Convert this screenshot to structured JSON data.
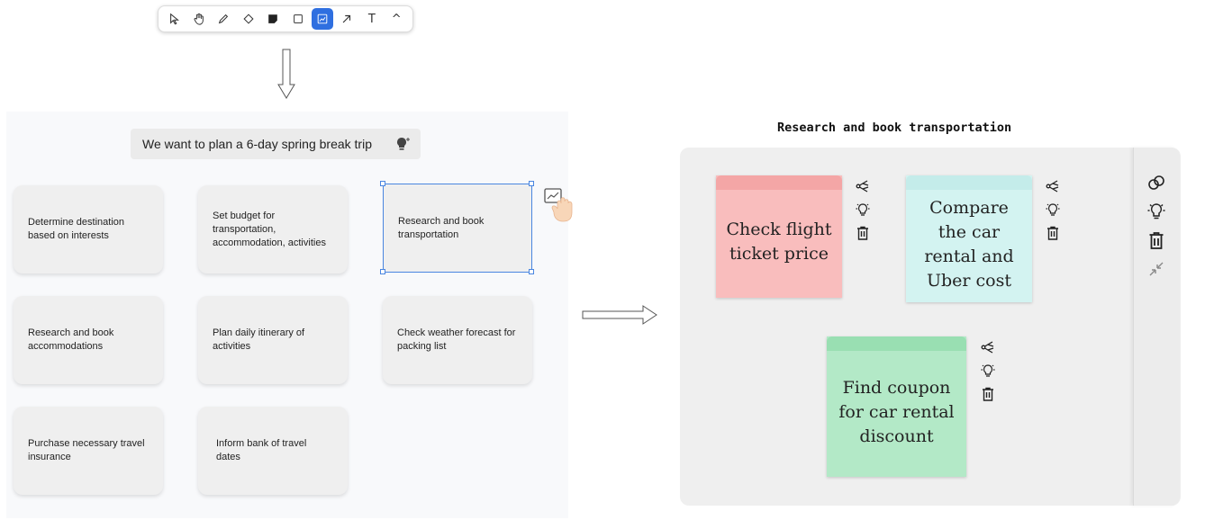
{
  "toolbar": {
    "tools": [
      "select-tool",
      "hand-tool",
      "pen-tool",
      "eraser-tool",
      "sticky-note-tool",
      "shape-tool",
      "ai-chart-tool",
      "arrow-tool",
      "text-tool",
      "collapse-tool"
    ],
    "active_tool": "ai-chart-tool",
    "text_tool_label": "T",
    "collapse_label": "^"
  },
  "left_panel": {
    "prompt": "We want to plan a 6-day spring break trip",
    "cards": [
      "Determine destination based on interests",
      "Set budget for transportation, accommodation, activities",
      "Research and book transportation",
      "Research and book accommodations",
      "Plan daily itinerary of activities",
      "Check weather forecast for packing list",
      "Purchase necessary travel insurance",
      "Inform bank of travel dates"
    ]
  },
  "right_panel": {
    "title": "Research and book transportation",
    "notes": [
      {
        "text": "Check flight ticket price",
        "color": "#f9bdbd",
        "tab_color": "#f4a6a6"
      },
      {
        "text": "Compare the car rental and Uber cost",
        "color": "#d3f3f1",
        "tab_color": "#c4ecea"
      },
      {
        "text": "Find coupon for car rental discount",
        "color": "#b3e9c7",
        "tab_color": "#99dfb2"
      }
    ],
    "note_tools": [
      "share-icon",
      "lightbulb-icon",
      "trash-icon"
    ],
    "sidebar_tools": [
      "link-icon",
      "lightbulb-icon",
      "trash-icon",
      "collapse-icon"
    ]
  },
  "colors": {
    "accent": "#2f6fe0",
    "selection": "#4a86e0"
  }
}
